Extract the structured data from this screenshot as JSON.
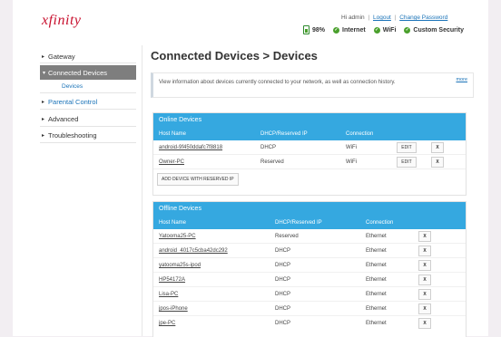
{
  "header": {
    "logo": "xfinity",
    "greeting": "Hi admin",
    "logout": "Logout",
    "change_password": "Change Password",
    "separator": "|",
    "battery": "98%",
    "internet": "Internet",
    "wifi": "WiFi",
    "security": "Custom Security"
  },
  "sidebar": {
    "gateway": "Gateway",
    "connected_devices": "Connected Devices",
    "devices": "Devices",
    "parental_control": "Parental Control",
    "advanced": "Advanced",
    "troubleshooting": "Troubleshooting"
  },
  "main": {
    "title": "Connected Devices > Devices",
    "info": "View information about devices currently connected to your network, as well as connection history.",
    "more": "more"
  },
  "online": {
    "title": "Online Devices",
    "headers": {
      "host": "Host Name",
      "dhcp": "DHCP/Reserved IP",
      "connection": "Connection"
    },
    "rows": [
      {
        "host": "android-9f450ddafc7f8818",
        "dhcp": "DHCP",
        "connection": "WiFi",
        "edit": "EDIT",
        "x": "X"
      },
      {
        "host": "Owner-PC",
        "dhcp": "Reserved",
        "connection": "WiFi",
        "edit": "EDIT",
        "x": "X"
      }
    ],
    "add_button": "ADD DEVICE WITH RESERVED IP"
  },
  "offline": {
    "title": "Offline Devices",
    "headers": {
      "host": "Host Name",
      "dhcp": "DHCP/Reserved IP",
      "connection": "Connection"
    },
    "rows": [
      {
        "host": "Yatooma25-PC",
        "dhcp": "Reserved",
        "connection": "Ethernet",
        "x": "X"
      },
      {
        "host": "android_4017c5cba42dc292",
        "dhcp": "DHCP",
        "connection": "Ethernet",
        "x": "X"
      },
      {
        "host": "yatooma25s-ipod",
        "dhcp": "DHCP",
        "connection": "Ethernet",
        "x": "X"
      },
      {
        "host": "HP54172A",
        "dhcp": "DHCP",
        "connection": "Ethernet",
        "x": "X"
      },
      {
        "host": "Lisa-PC",
        "dhcp": "DHCP",
        "connection": "Ethernet",
        "x": "X"
      },
      {
        "host": "jpos-iPhone",
        "dhcp": "DHCP",
        "connection": "Ethernet",
        "x": "X"
      },
      {
        "host": "jpe-PC",
        "dhcp": "DHCP",
        "connection": "Ethernet",
        "x": "X"
      }
    ]
  }
}
